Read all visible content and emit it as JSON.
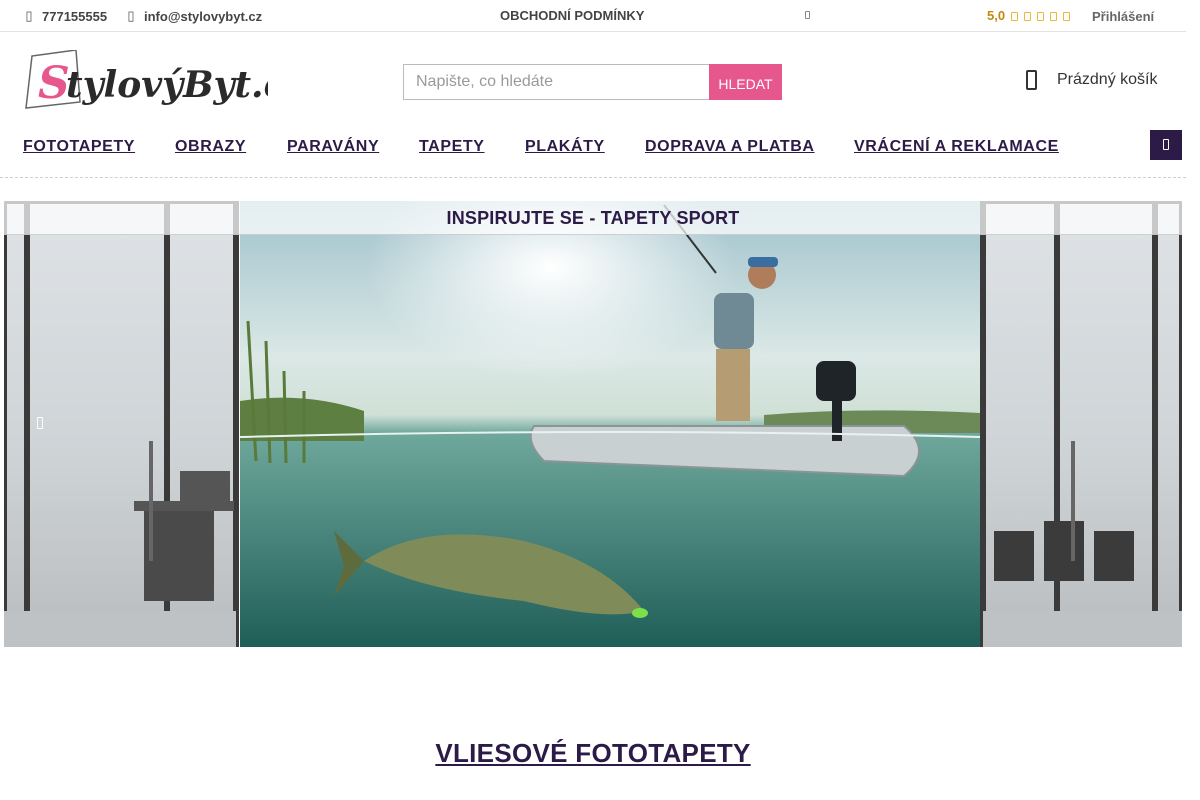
{
  "topbar": {
    "phone": "777155555",
    "email": "info@stylovybyt.cz",
    "terms": "OBCHODNÍ PODMÍNKY",
    "rating": "5,0",
    "login": "Přihlášení"
  },
  "header": {
    "logo_text": "StylovýByt.cz",
    "search_placeholder": "Napište, co hledáte",
    "search_button": "HLEDAT",
    "cart_label": "Prázdný košík"
  },
  "nav": {
    "items": [
      "FOTOTAPETY",
      "OBRAZY",
      "PARAVÁNY",
      "TAPETY",
      "PLAKÁTY",
      "DOPRAVA A PLATBA",
      "VRÁCENÍ A REKLAMACE"
    ]
  },
  "hero": {
    "title": "INSPIRUJTE SE - TAPETY SPORT"
  },
  "section": {
    "title": "VLIESOVÉ FOTOTAPETY"
  },
  "colors": {
    "brand_pink": "#e5578d",
    "brand_purple": "#2d1b47",
    "rating_gold": "#c28a0c"
  }
}
